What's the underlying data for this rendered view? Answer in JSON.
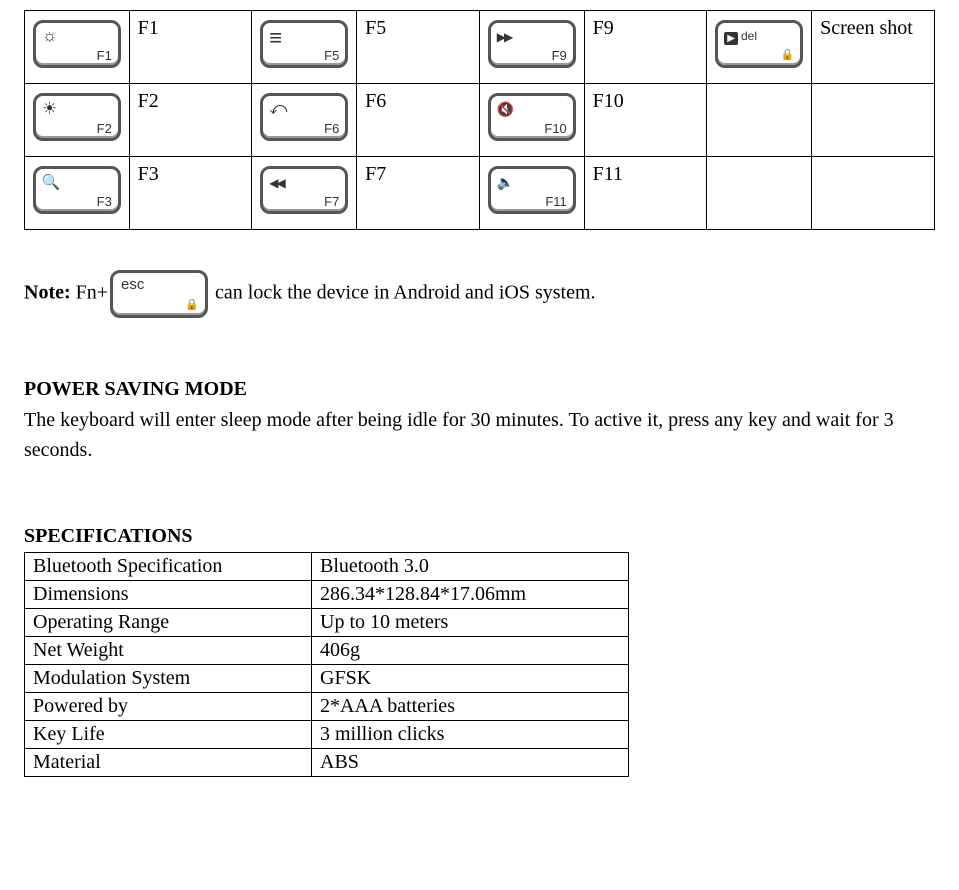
{
  "fn_table": {
    "rows": [
      [
        {
          "icon": "brightness",
          "sub": "F1",
          "label": "F1"
        },
        {
          "icon": "menu",
          "sub": "F5",
          "label": "F5"
        },
        {
          "icon": "forward",
          "sub": "F9",
          "label": "F9"
        },
        {
          "icon": "camera",
          "sub": "del",
          "extra_lock": true,
          "label": "Screen shot"
        }
      ],
      [
        {
          "icon": "brightness2",
          "sub": "F2",
          "label": "F2"
        },
        {
          "icon": "back",
          "sub": "F6",
          "label": "F6"
        },
        {
          "icon": "mute",
          "sub": "F10",
          "label": "F10"
        },
        {
          "icon": "",
          "sub": "",
          "label": ""
        }
      ],
      [
        {
          "icon": "search",
          "sub": "F3",
          "label": "F3"
        },
        {
          "icon": "rewind",
          "sub": "F7",
          "label": "F7"
        },
        {
          "icon": "voldown",
          "sub": "F11",
          "label": "F11"
        },
        {
          "icon": "",
          "sub": "",
          "label": ""
        }
      ]
    ]
  },
  "note": {
    "prefix_bold": "Note:",
    "prefix_rest": " Fn+",
    "esc_key_top": "esc",
    "suffix": " can lock the device in Android and iOS system."
  },
  "power": {
    "heading": "POWER SAVING MODE",
    "body": "The keyboard will enter sleep mode after being idle for 30 minutes. To active it, press any key and wait for 3 seconds."
  },
  "specs": {
    "heading": "SPECIFICATIONS",
    "rows": [
      {
        "k": "Bluetooth Specification",
        "v": "Bluetooth 3.0"
      },
      {
        "k": "Dimensions",
        "v": "286.34*128.84*17.06mm"
      },
      {
        "k": "Operating Range",
        "v": "Up to 10 meters"
      },
      {
        "k": "Net Weight",
        "v": "406g"
      },
      {
        "k": "Modulation System",
        "v": "GFSK"
      },
      {
        "k": "Powered by",
        "v": "2*AAA batteries"
      },
      {
        "k": "Key Life",
        "v": "3 million clicks"
      },
      {
        "k": "Material",
        "v": "ABS"
      }
    ]
  }
}
